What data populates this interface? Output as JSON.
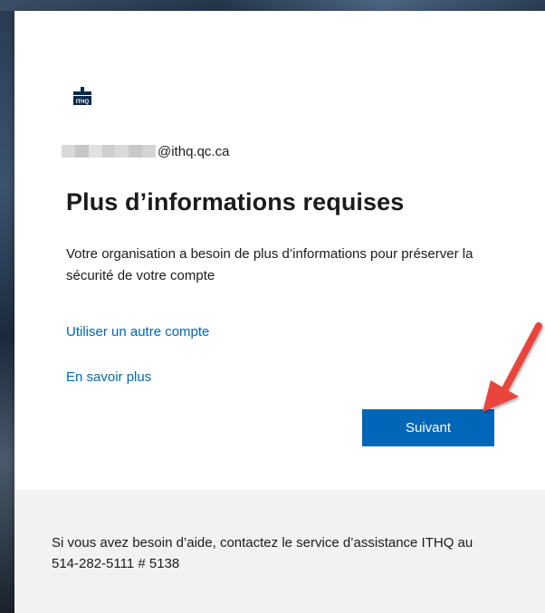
{
  "account": {
    "email_domain": "@ithq.qc.ca"
  },
  "logo": {
    "icon": "ithq-logo-icon",
    "text": "ITHQ"
  },
  "heading": {
    "title": "Plus d’informations requises",
    "description": "Votre organisation a besoin de plus d’informations pour préserver la sécurité de votre compte"
  },
  "links": {
    "use_other_account": "Utiliser un autre compte",
    "learn_more": "En savoir plus"
  },
  "actions": {
    "next_label": "Suivant"
  },
  "footer": {
    "help_text": "Si vous avez besoin d’aide, contactez le service d’assistance ITHQ au 514-282-5111 # 5138"
  },
  "colors": {
    "accent": "#0067b8",
    "link": "#0067b8",
    "footer_bg": "#f2f2f2",
    "annotation_arrow": "#e8453c"
  },
  "annotation": {
    "icon": "red-arrow-icon"
  }
}
